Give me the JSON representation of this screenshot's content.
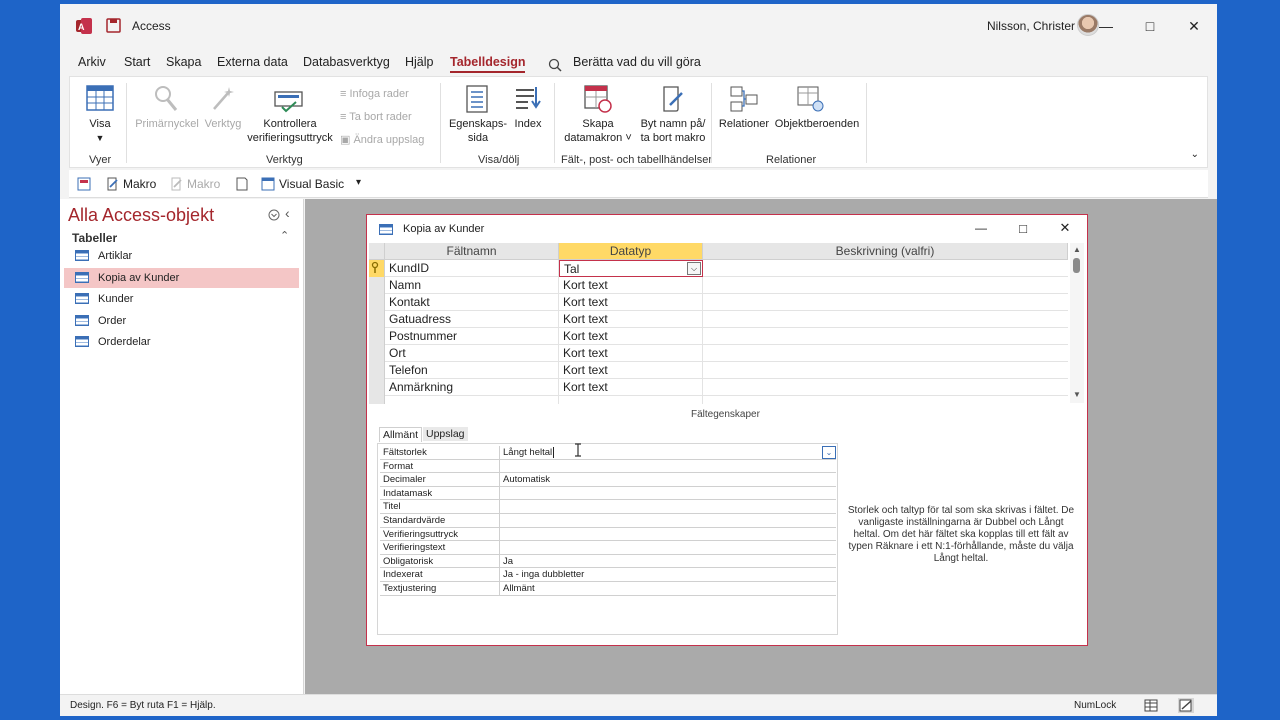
{
  "app": {
    "title": "Access",
    "user": "Nilsson, Christer"
  },
  "menu": {
    "items": [
      "Arkiv",
      "Start",
      "Skapa",
      "Externa data",
      "Databasverktyg",
      "Hjälp",
      "Tabelldesign"
    ],
    "search": "Berätta vad du vill göra"
  },
  "ribbon": {
    "visa": "Visa",
    "primarnyckel": "Primärnyckel",
    "verktyg": "Verktyg",
    "kontrollera1": "Kontrollera",
    "kontrollera2": "verifieringsuttryck",
    "infoga": "Infoga rader",
    "tabort": "Ta bort rader",
    "andra": "Ändra uppslag",
    "egenskap1": "Egenskaps-",
    "egenskap2": "sida",
    "index": "Index",
    "skapa1": "Skapa",
    "skapa2": "datamakron",
    "byt1": "Byt namn på/",
    "byt2": "ta bort makro",
    "relationer": "Relationer",
    "objektberoenden": "Objektberoenden",
    "groups": {
      "vyer": "Vyer",
      "verktyg": "Verktyg",
      "visadolj": "Visa/dölj",
      "falt": "Fält-, post- och tabellhändelser",
      "relationer": "Relationer"
    }
  },
  "qat": {
    "makro1": "Makro",
    "makro2": "Makro",
    "vb": "Visual Basic"
  },
  "nav": {
    "title": "Alla Access-objekt",
    "section": "Tabeller",
    "items": [
      "Artiklar",
      "Kopia av Kunder",
      "Kunder",
      "Order",
      "Orderdelar"
    ]
  },
  "doc": {
    "title": "Kopia av Kunder",
    "headers": {
      "faltnamn": "Fältnamn",
      "datatyp": "Datatyp",
      "beskrivning": "Beskrivning (valfri)"
    },
    "rows": [
      {
        "name": "KundID",
        "type": "Tal"
      },
      {
        "name": "Namn",
        "type": "Kort text"
      },
      {
        "name": "Kontakt",
        "type": "Kort text"
      },
      {
        "name": "Gatuadress",
        "type": "Kort text"
      },
      {
        "name": "Postnummer",
        "type": "Kort text"
      },
      {
        "name": "Ort",
        "type": "Kort text"
      },
      {
        "name": "Telefon",
        "type": "Kort text"
      },
      {
        "name": "Anmärkning",
        "type": "Kort text"
      }
    ],
    "field_props_title": "Fältegenskaper",
    "tabs": [
      "Allmänt",
      "Uppslag"
    ],
    "props": [
      {
        "k": "Fältstorlek",
        "v": "Långt heltal"
      },
      {
        "k": "Format",
        "v": ""
      },
      {
        "k": "Decimaler",
        "v": "Automatisk"
      },
      {
        "k": "Indatamask",
        "v": ""
      },
      {
        "k": "Titel",
        "v": ""
      },
      {
        "k": "Standardvärde",
        "v": ""
      },
      {
        "k": "Verifieringsuttryck",
        "v": ""
      },
      {
        "k": "Verifieringstext",
        "v": ""
      },
      {
        "k": "Obligatorisk",
        "v": "Ja"
      },
      {
        "k": "Indexerat",
        "v": "Ja - inga dubbletter"
      },
      {
        "k": "Textjustering",
        "v": "Allmänt"
      }
    ],
    "help": "Storlek och taltyp för tal som ska skrivas i fältet. De vanligaste inställningarna är Dubbel och Långt heltal. Om det här fältet ska kopplas till ett fält av typen Räknare i ett N:1-förhållande, måste du välja Långt heltal."
  },
  "status": {
    "left": "Design.  F6 = Byt ruta  F1 = Hjälp.",
    "numlock": "NumLock"
  }
}
